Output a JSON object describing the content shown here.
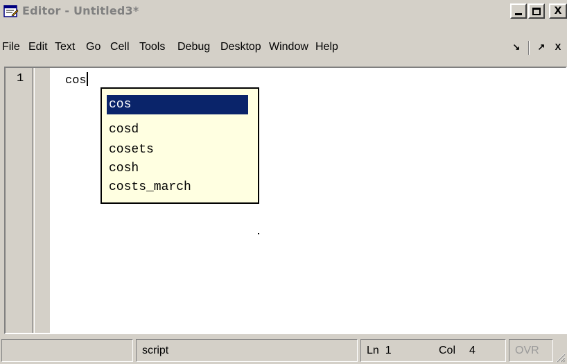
{
  "window": {
    "title": "Editor - Untitled3*",
    "controls": {
      "minimize": "_",
      "maximize": "□",
      "close": "X"
    }
  },
  "menubar": {
    "items": [
      "File",
      "Edit",
      "Text",
      "Go",
      "Cell",
      "Tools",
      "Debug",
      "Desktop",
      "Window",
      "Help"
    ],
    "dock_icon": "dock-arrow-icon",
    "undock_symbol": "↘",
    "maximize_symbol": "↗",
    "close_symbol": "X"
  },
  "editor": {
    "line_number": "1",
    "code": "cos"
  },
  "autocomplete": {
    "items": [
      "cos",
      "cosd",
      "cosets",
      "cosh",
      "costs_march"
    ],
    "selected_index": 0
  },
  "statusbar": {
    "mode": "script",
    "ln_label": "Ln",
    "ln_value": "1",
    "col_label": "Col",
    "col_value": "4",
    "ovr": "OVR"
  },
  "colors": {
    "selection": "#0a246a",
    "popup_bg": "#ffffe1",
    "chrome": "#d4d0c8"
  }
}
